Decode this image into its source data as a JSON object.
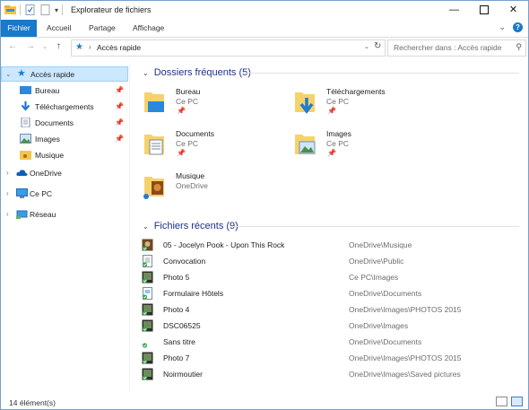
{
  "window": {
    "title": "Explorateur de fichiers"
  },
  "ribbon": {
    "tabs": [
      "Fichier",
      "Accueil",
      "Partage",
      "Affichage"
    ],
    "help_icon": "help-icon"
  },
  "address": {
    "breadcrumb": "Accès rapide",
    "search_placeholder": "Rechercher dans : Accès rapide"
  },
  "sidebar": {
    "quick_access": "Accès rapide",
    "items": [
      {
        "label": "Bureau",
        "icon": "desktop-icon",
        "pinned": true
      },
      {
        "label": "Téléchargements",
        "icon": "download-icon",
        "pinned": true
      },
      {
        "label": "Documents",
        "icon": "documents-icon",
        "pinned": true
      },
      {
        "label": "Images",
        "icon": "images-icon",
        "pinned": true
      },
      {
        "label": "Musique",
        "icon": "music-icon",
        "pinned": false
      }
    ],
    "onedrive": "OneDrive",
    "thispc": "Ce PC",
    "network": "Réseau"
  },
  "frequent": {
    "heading": "Dossiers fréquents (5)",
    "folders": [
      {
        "name": "Bureau",
        "location": "Ce PC",
        "pinned": true
      },
      {
        "name": "Téléchargements",
        "location": "Ce PC",
        "pinned": true
      },
      {
        "name": "Documents",
        "location": "Ce PC",
        "pinned": true
      },
      {
        "name": "Images",
        "location": "Ce PC",
        "pinned": true
      },
      {
        "name": "Musique",
        "location": "OneDrive",
        "pinned": false
      }
    ]
  },
  "recent": {
    "heading": "Fichiers récents (9)",
    "files": [
      {
        "name": "05 - Jocelyn Pook - Upon This Rock",
        "path": "OneDrive\\Musique",
        "icon": "audio-file-icon"
      },
      {
        "name": "Convocation",
        "path": "OneDrive\\Public",
        "icon": "document-file-icon"
      },
      {
        "name": "Photo 5",
        "path": "Ce PC\\Images",
        "icon": "photo-file-icon"
      },
      {
        "name": "Formulaire Hôtels",
        "path": "OneDrive\\Documents",
        "icon": "form-file-icon"
      },
      {
        "name": "Photo 4",
        "path": "OneDrive\\Images\\PHOTOS 2015",
        "icon": "photo-file-icon"
      },
      {
        "name": "DSC06525",
        "path": "OneDrive\\Images",
        "icon": "photo-file-icon"
      },
      {
        "name": "Sans titre",
        "path": "OneDrive\\Documents",
        "icon": "blank-file-icon"
      },
      {
        "name": "Photo 7",
        "path": "OneDrive\\Images\\PHOTOS 2015",
        "icon": "photo-file-icon"
      },
      {
        "name": "Noirmoutier",
        "path": "OneDrive\\Images\\Saved pictures",
        "icon": "photo-file-icon"
      }
    ]
  },
  "status": {
    "count": "14 élément(s)"
  },
  "colors": {
    "accent": "#1979ca",
    "heading": "#1e3287",
    "selection": "#cce8ff"
  }
}
